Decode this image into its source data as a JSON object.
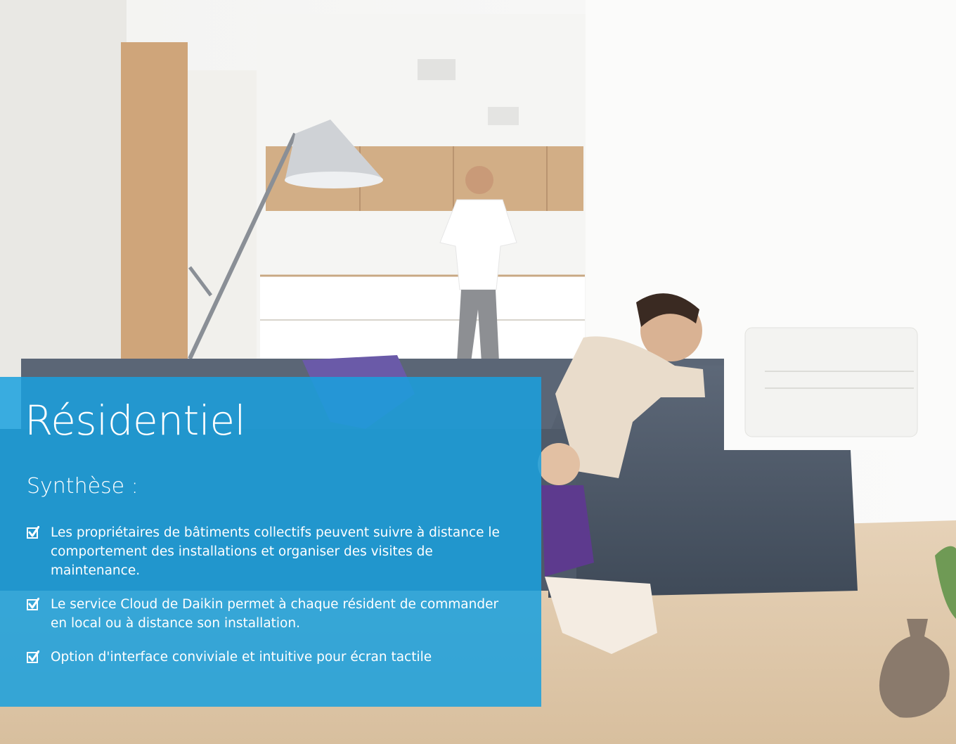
{
  "section": {
    "title": "Résidentiel",
    "subtitle": "Synthèse :"
  },
  "features": [
    {
      "text": "Les propriétaires de bâtiments collectifs peuvent suivre à distance le comportement des installations et organiser des visites de maintenance."
    },
    {
      "text": "Le service Cloud de Daikin permet à chaque résident de commander en local ou à distance son installation."
    },
    {
      "text": "Option d'interface conviviale et intuitive pour écran tactile"
    }
  ],
  "icons": {
    "checkbox": "checked-box-icon"
  },
  "colors": {
    "overlay": "#1aa0dd",
    "text": "#ffffff"
  }
}
